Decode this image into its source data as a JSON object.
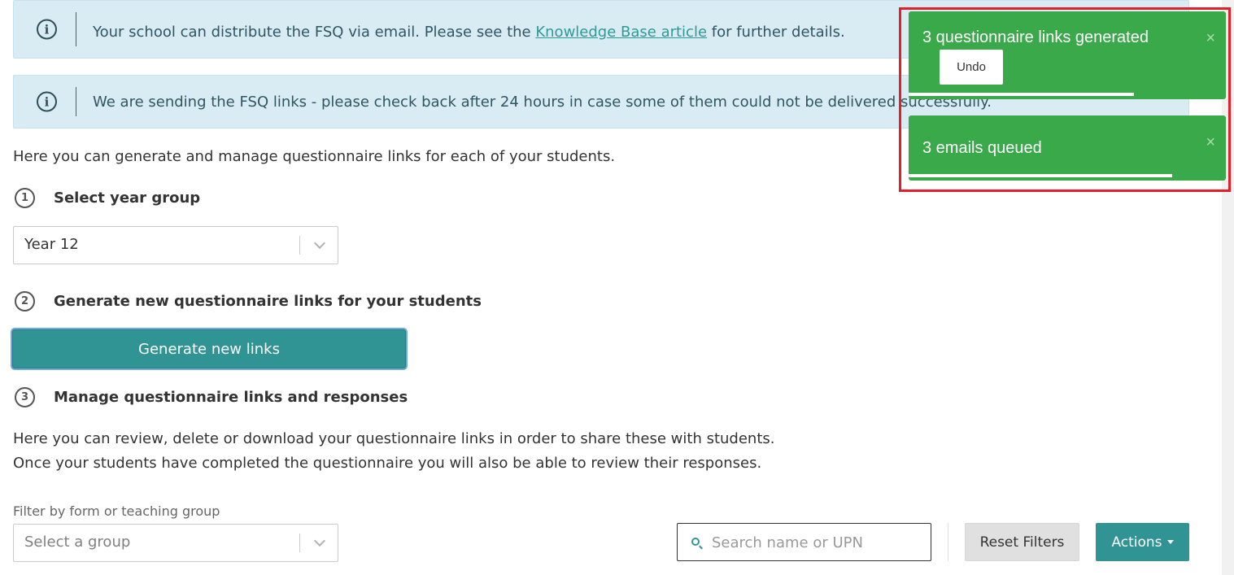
{
  "alerts": {
    "distribute": {
      "text_before": "Your school can distribute the FSQ via email. Please see the ",
      "link": "Knowledge Base article",
      "text_after": " for further details."
    },
    "sending": {
      "text": "We are sending the FSQ links - please check back after 24 hours in case some of them could not be delivered successfully."
    }
  },
  "intro_text": "Here you can generate and manage questionnaire links for each of your students.",
  "steps": [
    {
      "number": "1",
      "title": "Select year group"
    },
    {
      "number": "2",
      "title": "Generate new questionnaire links for your students"
    },
    {
      "number": "3",
      "title": "Manage questionnaire links and responses"
    }
  ],
  "year_select": {
    "value": "Year 12"
  },
  "generate_button": "Generate new links",
  "manage_description": "Here you can review, delete or download your questionnaire links in order to share these with students. Once your students have completed the questionnaire you will also be able to review their responses.",
  "filter": {
    "label": "Filter by form or teaching group",
    "placeholder": "Select a group"
  },
  "search": {
    "placeholder": "Search name or UPN"
  },
  "buttons": {
    "reset": "Reset Filters",
    "actions": "Actions"
  },
  "toasts": [
    {
      "message": "3 questionnaire links generated",
      "action": "Undo",
      "close": "×",
      "progress": 0.71
    },
    {
      "message": "3 emails queued",
      "close": "×",
      "progress": 0.83
    }
  ],
  "colors": {
    "primary": "#319494",
    "toast_success": "#3aa94a",
    "alert_bg": "#d9ecf3",
    "highlight": "#e3202a"
  }
}
